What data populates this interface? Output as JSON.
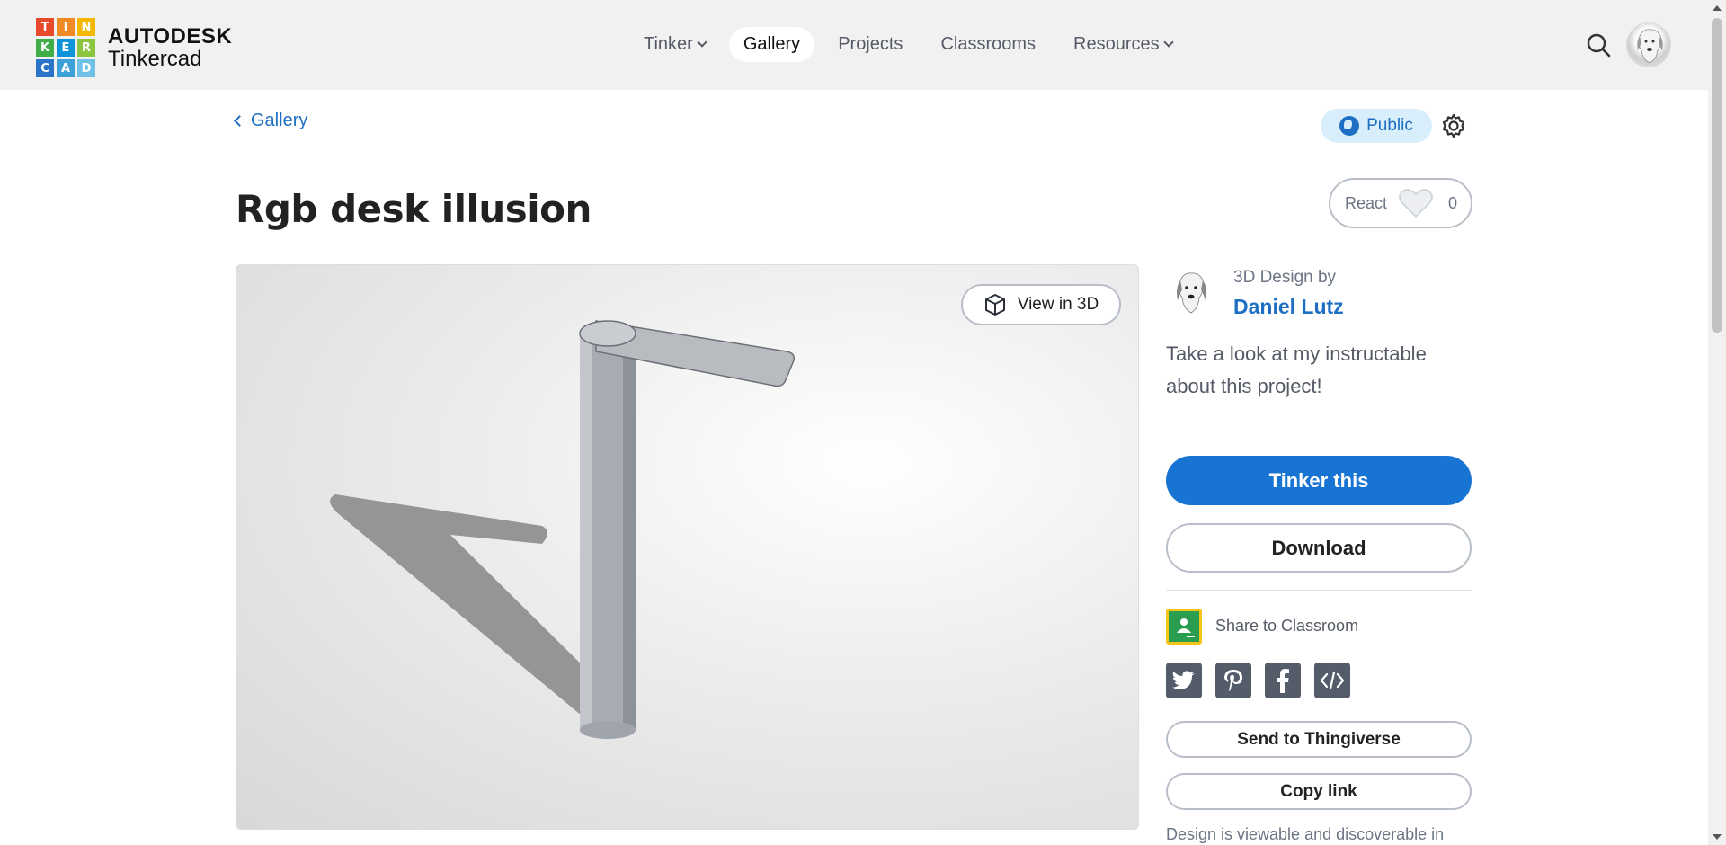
{
  "header": {
    "logo_brand": "AUTODESK",
    "logo_product": "Tinkercad",
    "logo_letters": [
      "T",
      "I",
      "N",
      "K",
      "E",
      "R",
      "C",
      "A",
      "D"
    ],
    "logo_colors": [
      "#e8492a",
      "#f08a24",
      "#f5b800",
      "#3fae49",
      "#0d94d8",
      "#8cc63f",
      "#2a74c9",
      "#3aa1d9",
      "#6fc1e8"
    ],
    "nav": [
      {
        "label": "Tinker",
        "dropdown": true
      },
      {
        "label": "Gallery",
        "active": true
      },
      {
        "label": "Projects"
      },
      {
        "label": "Classrooms"
      },
      {
        "label": "Resources",
        "dropdown": true
      }
    ],
    "search_icon": "search-icon"
  },
  "breadcrumb": {
    "back_label": "Gallery"
  },
  "visibility": {
    "label": "Public",
    "icon": "globe-icon"
  },
  "design": {
    "title": "Rgb desk illusion",
    "react_label": "React",
    "react_count": "0",
    "view_3d_label": "View in 3D"
  },
  "author": {
    "design_by": "3D Design by",
    "name": "Daniel Lutz",
    "description": "Take a look at my instructable about this project!"
  },
  "actions": {
    "tinker": "Tinker this",
    "download": "Download",
    "share_classroom": "Share to Classroom",
    "thingiverse": "Send to Thingiverse",
    "copy_link": "Copy link",
    "viewable_note": "Design is viewable and discoverable in"
  },
  "socials": [
    "twitter-icon",
    "pinterest-icon",
    "facebook-icon",
    "embed-code-icon"
  ],
  "colors": {
    "accent": "#1874d2",
    "link": "#1e6fc4",
    "public_bg": "#d8effb"
  }
}
